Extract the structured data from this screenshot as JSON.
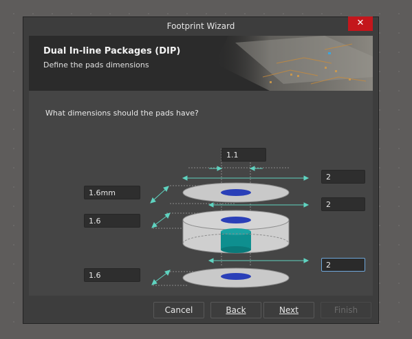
{
  "window": {
    "title": "Footprint Wizard",
    "close_glyph": "✕"
  },
  "banner": {
    "heading": "Dual In-line Packages (DIP)",
    "subheading": "Define the pads dimensions"
  },
  "question": "What dimensions should the pads have?",
  "fields": {
    "top_hole": "1.1",
    "top_pad_diameter": "2",
    "middle_pad_diameter": "2",
    "bottom_pad_diameter": "2",
    "top_pad_length": "1.6mm",
    "middle_pad_length": "1.6",
    "bottom_pad_length": "1.6"
  },
  "buttons": {
    "cancel": "Cancel",
    "back": "Back",
    "next": "Next",
    "finish": "Finish"
  },
  "colors": {
    "pad": "#c9c9c9",
    "hole": "#2a3fb8",
    "barrel": "#0e8f8f",
    "dimension_arrow": "#5fd3c0",
    "focus_border": "#6fa8dc"
  }
}
